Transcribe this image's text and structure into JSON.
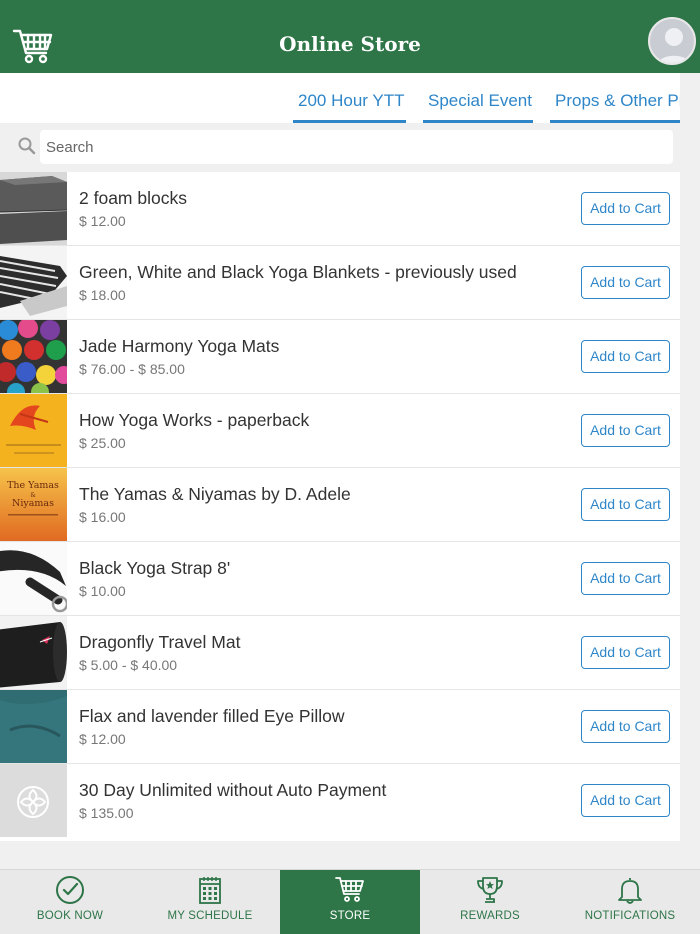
{
  "header": {
    "title": "Online Store",
    "colors": {
      "brand": "#2e7548",
      "accent": "#2e86c9"
    }
  },
  "tabs": [
    {
      "label": "200 Hour YTT"
    },
    {
      "label": "Special Event"
    },
    {
      "label": "Props & Other Pr"
    }
  ],
  "search": {
    "placeholder": "Search"
  },
  "products": [
    {
      "name": "2 foam blocks",
      "price": "$ 12.00",
      "button": "Add to Cart",
      "thumb": "foam-blocks-image"
    },
    {
      "name": "Green, White and Black Yoga Blankets - previously used",
      "price": "$ 18.00",
      "button": "Add to Cart",
      "thumb": "yoga-blankets-image"
    },
    {
      "name": "Jade Harmony Yoga Mats",
      "price": "$ 76.00 - $ 85.00",
      "button": "Add to Cart",
      "thumb": "yoga-mats-image"
    },
    {
      "name": "How Yoga Works - paperback",
      "price": "$ 25.00",
      "button": "Add to Cart",
      "thumb": "book-cover-image"
    },
    {
      "name": "The Yamas & Niyamas by D. Adele",
      "price": "$ 16.00",
      "button": "Add to Cart",
      "thumb": "book-cover-image"
    },
    {
      "name": "Black Yoga Strap 8'",
      "price": "$ 10.00",
      "button": "Add to Cart",
      "thumb": "yoga-strap-image"
    },
    {
      "name": "Dragonfly Travel Mat",
      "price": "$ 5.00 - $ 40.00",
      "button": "Add to Cart",
      "thumb": "travel-mat-image"
    },
    {
      "name": "Flax and lavender filled Eye Pillow",
      "price": "$ 12.00",
      "button": "Add to Cart",
      "thumb": "eye-pillow-image"
    },
    {
      "name": "30 Day Unlimited without Auto Payment",
      "price": "$ 135.00",
      "button": "Add to Cart",
      "thumb": "lotus-placeholder-image"
    }
  ],
  "thumb_text": {
    "yamas_line1": "The Yamas",
    "yamas_line2": "&",
    "yamas_line3": "Niyamas"
  },
  "bottom_nav": [
    {
      "label": "BOOK NOW",
      "icon": "check-circle-icon"
    },
    {
      "label": "MY SCHEDULE",
      "icon": "calendar-icon"
    },
    {
      "label": "STORE",
      "icon": "cart-icon",
      "active": true
    },
    {
      "label": "REWARDS",
      "icon": "trophy-icon"
    },
    {
      "label": "NOTIFICATIONS",
      "icon": "bell-icon"
    }
  ]
}
